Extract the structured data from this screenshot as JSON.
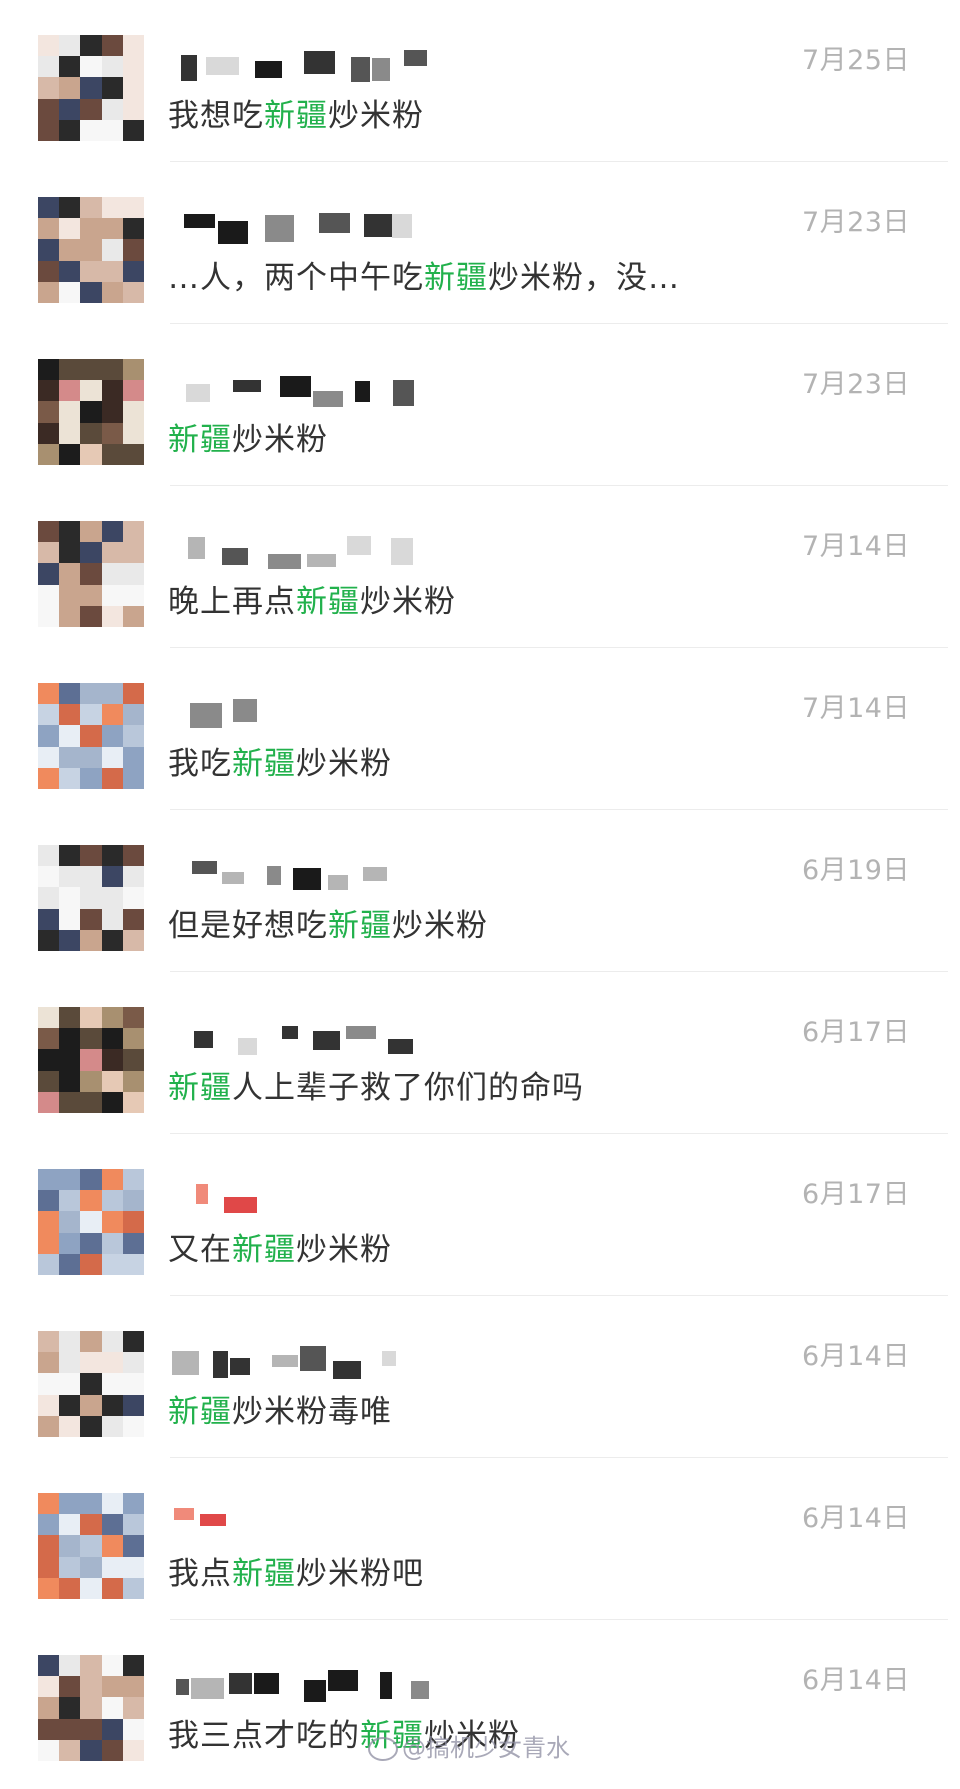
{
  "colors": {
    "highlight": "#22b14c",
    "text": "#333333",
    "date": "#b3b3b3"
  },
  "results": [
    {
      "date": "7月25日",
      "pre": "我想吃",
      "hl": "新疆",
      "post": "炒米粉"
    },
    {
      "date": "7月23日",
      "pre": "…人，两个中午吃",
      "hl": "新疆",
      "post": "炒米粉，没…"
    },
    {
      "date": "7月23日",
      "pre": "",
      "hl": "新疆",
      "post": "炒米粉"
    },
    {
      "date": "7月14日",
      "pre": "晚上再点",
      "hl": "新疆",
      "post": "炒米粉"
    },
    {
      "date": "7月14日",
      "pre": "我吃",
      "hl": "新疆",
      "post": "炒米粉"
    },
    {
      "date": "6月19日",
      "pre": "但是好想吃",
      "hl": "新疆",
      "post": "炒米粉"
    },
    {
      "date": "6月17日",
      "pre": "",
      "hl": "新疆",
      "post": "人上辈子救了你们的命吗"
    },
    {
      "date": "6月17日",
      "pre": "又在",
      "hl": "新疆",
      "post": "炒米粉"
    },
    {
      "date": "6月14日",
      "pre": "",
      "hl": "新疆",
      "post": "炒米粉毒唯"
    },
    {
      "date": "6月14日",
      "pre": "我点",
      "hl": "新疆",
      "post": "炒米粉吧"
    },
    {
      "date": "6月14日",
      "pre": "我三点才吃的",
      "hl": "新疆",
      "post": "炒米粉"
    }
  ],
  "watermark": "@搞机少女青水"
}
